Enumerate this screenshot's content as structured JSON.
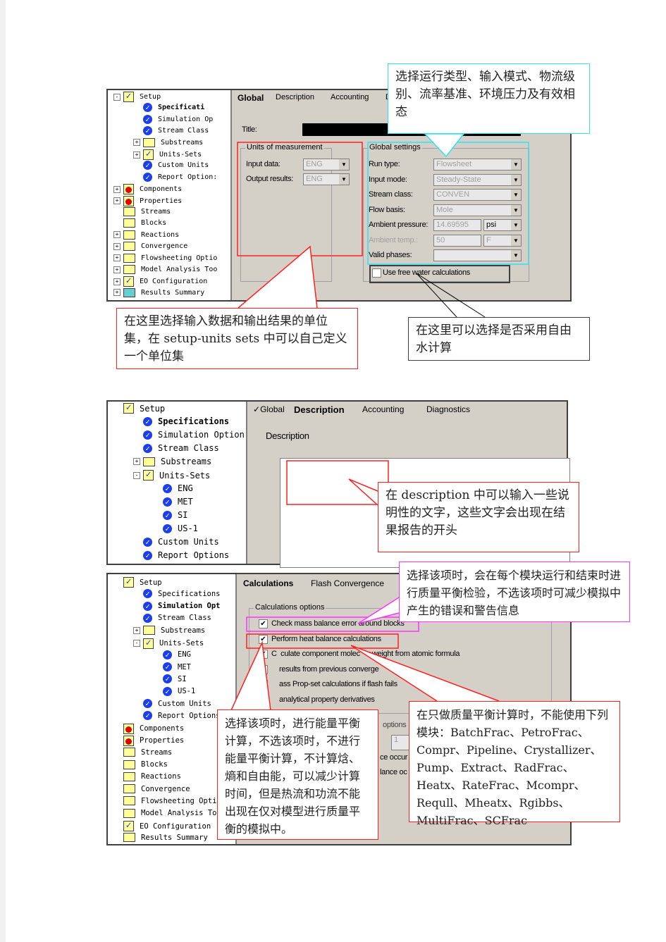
{
  "colors": {
    "callout_red": "#ff2020",
    "callout_cyan": "#33e0f0",
    "callout_magenta": "#ff33ff",
    "dialog_bg": "#d4d0c8"
  },
  "shot1": {
    "tree": [
      {
        "t": "Setup",
        "l": 0,
        "i": "check",
        "e": "-"
      },
      {
        "t": "Specificati",
        "l": 1,
        "i": "blue",
        "b": true
      },
      {
        "t": "Simulation Op",
        "l": 1,
        "i": "blue"
      },
      {
        "t": "Stream Class",
        "l": 1,
        "i": "blue"
      },
      {
        "t": "Substreams",
        "l": 1,
        "i": "folder",
        "e": "+"
      },
      {
        "t": "Units-Sets",
        "l": 1,
        "i": "check",
        "e": "+"
      },
      {
        "t": "Custom Units",
        "l": 1,
        "i": "blue"
      },
      {
        "t": "Report Option:",
        "l": 1,
        "i": "blue"
      },
      {
        "t": "Components",
        "l": 0,
        "i": "red",
        "e": "+"
      },
      {
        "t": "Properties",
        "l": 0,
        "i": "red",
        "e": "+"
      },
      {
        "t": "Streams",
        "l": 0,
        "i": "folder"
      },
      {
        "t": "Blocks",
        "l": 0,
        "i": "folder"
      },
      {
        "t": "Reactions",
        "l": 0,
        "i": "folder",
        "e": "+"
      },
      {
        "t": "Convergence",
        "l": 0,
        "i": "folder",
        "e": "+"
      },
      {
        "t": "Flowsheeting Optio",
        "l": 0,
        "i": "folder",
        "e": "+"
      },
      {
        "t": "Model Analysis Too",
        "l": 0,
        "i": "folder",
        "e": "+"
      },
      {
        "t": "EO Configuration",
        "l": 0,
        "i": "check",
        "e": "+"
      },
      {
        "t": "Results Summary",
        "l": 0,
        "i": "cyanfolder",
        "e": "+"
      }
    ],
    "tabs": [
      "Global",
      "Description",
      "Accounting",
      "D"
    ],
    "title_label": "Title:",
    "units_group": "Units of measurement",
    "input_data": "Input data:",
    "input_data_value": "ENG",
    "output_results": "Output results:",
    "output_results_value": "ENG",
    "global_group": "Global settings",
    "run_type": "Run type:",
    "run_type_value": "Flowsheet",
    "input_mode": "Input mode:",
    "input_mode_value": "Steady-State",
    "stream_class": "Stream class:",
    "stream_class_value": "CONVEN",
    "flow_basis": "Flow basis:",
    "flow_basis_value": "Mole",
    "ambient_pressure": "Ambient pressure:",
    "ambient_pressure_value": "14.69595",
    "pressure_unit": "psi",
    "ambient_temp": "Ambient temp.:",
    "ambient_temp_value": "50",
    "temp_unit": "F",
    "valid_phases": "Valid phases:",
    "valid_phases_value": "",
    "free_water": "Use free water calculations",
    "free_water_checked": false,
    "callout_top": "选择运行类型、输入模式、物流级别、流率基准、环境压力及有效相态",
    "callout_left": "在这里选择输入数据和输出结果的单位集，在 setup-units sets 中可以自己定义一个单位集",
    "callout_right": "在这里可以选择是否采用自由水计算"
  },
  "shot2": {
    "tree": [
      {
        "t": "Setup",
        "l": 0,
        "i": "check"
      },
      {
        "t": "Specifications",
        "l": 1,
        "i": "blue",
        "b": true
      },
      {
        "t": "Simulation Option",
        "l": 1,
        "i": "blue"
      },
      {
        "t": "Stream Class",
        "l": 1,
        "i": "blue"
      },
      {
        "t": "Substreams",
        "l": 1,
        "i": "folder",
        "e": "+"
      },
      {
        "t": "Units-Sets",
        "l": 1,
        "i": "check",
        "e": "-"
      },
      {
        "t": "ENG",
        "l": 2,
        "i": "blue"
      },
      {
        "t": "MET",
        "l": 2,
        "i": "blue"
      },
      {
        "t": "SI",
        "l": 2,
        "i": "blue"
      },
      {
        "t": "US-1",
        "l": 2,
        "i": "blue"
      },
      {
        "t": "Custom Units",
        "l": 1,
        "i": "blue"
      },
      {
        "t": "Report Options",
        "l": 1,
        "i": "blue"
      }
    ],
    "tab_check": "✓",
    "tabs": [
      "Global",
      "Description",
      "Accounting",
      "Diagnostics"
    ],
    "description_label": "Description",
    "callout": "在 description 中可以输入一些说明性的文字，这些文字会出现在结果报告的开头"
  },
  "shot3": {
    "tree": [
      {
        "t": "Setup",
        "l": 0,
        "i": "check"
      },
      {
        "t": "Specifications",
        "l": 1,
        "i": "blue"
      },
      {
        "t": "Simulation Opt",
        "l": 1,
        "i": "blue",
        "b": true
      },
      {
        "t": "Stream Class",
        "l": 1,
        "i": "blue"
      },
      {
        "t": "Substreams",
        "l": 1,
        "i": "folder",
        "e": "+"
      },
      {
        "t": "Units-Sets",
        "l": 1,
        "i": "check",
        "e": "-"
      },
      {
        "t": "ENG",
        "l": 2,
        "i": "blue"
      },
      {
        "t": "MET",
        "l": 2,
        "i": "blue"
      },
      {
        "t": "SI",
        "l": 2,
        "i": "blue"
      },
      {
        "t": "US-1",
        "l": 2,
        "i": "blue"
      },
      {
        "t": "Custom Units",
        "l": 1,
        "i": "blue"
      },
      {
        "t": "Report Options",
        "l": 1,
        "i": "blue"
      },
      {
        "t": "Components",
        "l": 0,
        "i": "red"
      },
      {
        "t": "Properties",
        "l": 0,
        "i": "red"
      },
      {
        "t": "Streams",
        "l": 0,
        "i": "folder"
      },
      {
        "t": "Blocks",
        "l": 0,
        "i": "folder"
      },
      {
        "t": "Reactions",
        "l": 0,
        "i": "folder"
      },
      {
        "t": "Convergence",
        "l": 0,
        "i": "folder"
      },
      {
        "t": "Flowsheeting Optio",
        "l": 0,
        "i": "folder"
      },
      {
        "t": "Model Analysis Too",
        "l": 0,
        "i": "folder"
      },
      {
        "t": "EO Configuration",
        "l": 0,
        "i": "check"
      },
      {
        "t": "Results Summary",
        "l": 0,
        "i": "folder"
      }
    ],
    "tabs": [
      "Calculations",
      "Flash Convergence"
    ],
    "calc_group": "Calculations options",
    "options": [
      {
        "t": "Check mass balance error around blocks",
        "c": true
      },
      {
        "t": "Perform heat balance calculations",
        "c": true
      },
      {
        "t": "C  culate component molec    r weight from atomic formula",
        "c": true
      },
      {
        "t": "    results from previous converge         ass",
        "c": true
      },
      {
        "t": "    ass Prop-set calculations if flash fails",
        "c": true
      },
      {
        "t": "    analytical property derivatives",
        "c": false
      }
    ],
    "options2_label": "options",
    "options2_value": "1",
    "partial1": "ce occur",
    "partial2": "lance oc",
    "callout_magenta": "选择该项时，会在每个模块运行和结束时进行质量平衡检验，不选该项时可减少模拟中产生的错误和警告信息",
    "callout_heat": "选择该项时，进行能量平衡计算，不选该项时，不进行能量平衡计算，不计算焓、熵和自由能，可以减少计算时间，但是热流和功流不能出现在仅对模型进行质量平衡的模拟中。",
    "callout_blocks": "在只做质量平衡计算时，不能使用下列模块：BatchFrac、PetroFrac、Compr、Pipeline、Crystallizer、Pump、Extract、RadFrac、Heatx、RateFrac、Mcompr、Requll、Mheatx、Rgibbs、MultiFrac、SCFrac"
  }
}
